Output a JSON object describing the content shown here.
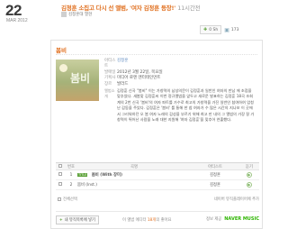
{
  "post": {
    "day": "22",
    "month_year": "MAR 2012",
    "title": "김정훈 소집고 다시 선 앨범, '여자 김정훈 등장!'",
    "time": "11시간전",
    "author": "김정훈대 열현"
  },
  "toolbar": {
    "share_label": "0 Sh",
    "comment_count": "173"
  },
  "album": {
    "title": "봄비",
    "cover_text": "봄비",
    "info": [
      {
        "label": "아티스트",
        "value": "김정훈",
        "link": true
      },
      {
        "label": "발매일",
        "value": "2012년 3월 22일, 목요일",
        "link": false
      },
      {
        "label": "기획사",
        "value": "미디어 로엔 엔터테인먼트",
        "link": false
      },
      {
        "label": "장르",
        "value": "발라드",
        "link": false
      }
    ],
    "description_label": "앨범소개",
    "description": "김정훈 신곡 \"봄비\" 이는 가창력의 남성의문이 김정훈과 일반인 여자의 만남 에 초점을 맞추었다. 새봄맞 김정훈씨 이번 정규앨범을 앞두고 새로운 발표하는 김정훈 18곡 조회계의 2번 신곡 '봄비'의 여자 파트를 가수로 최고의 가창력을 가진 일반인 참여하여 엄청난 감동을 주었다. 김정훈은 '봄비' 를 통해 한 참 여자가 수 많은 시간의 지나보 이 곳에서 그리워하던 오 봄 여자 노래의 감성을 부르기 위해 최고 만 내의 그 앨범의 가장 잘 가창력이 뛰어난 사람을 노래 대한 지원해 '여자 김정훈'을 맞추어 연출했다."
  },
  "tracks": {
    "headers": [
      "번호",
      "곡명",
      "아티스트",
      "듣기"
    ],
    "rows": [
      {
        "num": "1",
        "badge": "TITLE",
        "title": "봄비 (With 장미)",
        "artist": "김정훈",
        "bold": true
      },
      {
        "num": "2",
        "badge": "",
        "title": "봄비 (Inst.)",
        "artist": "김정훈",
        "bold": false
      }
    ]
  },
  "table_footer": {
    "select_all": "전체선택",
    "add_to_playlist": "네이버 뮤직플레이어에 추가"
  },
  "footer": {
    "open_button": "내 뮤직목록에 넣기",
    "fan_text_prefix": "이 앨범 에디터",
    "fan_count": "18개",
    "fan_text_suffix": "의 좋아요",
    "provider_label": "정보 제공",
    "provider_logo": "NAVER MUSIC"
  },
  "colors": {
    "accent_orange": "#e07020",
    "naver_green": "#2db400",
    "play_green": "#5aa036"
  }
}
